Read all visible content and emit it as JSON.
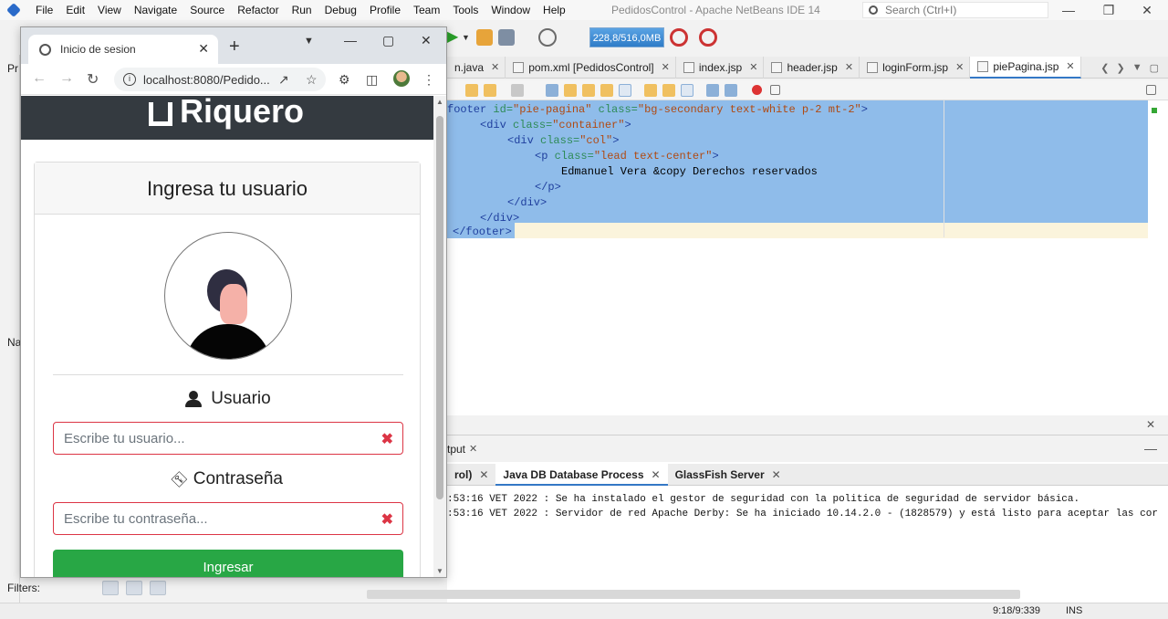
{
  "ide": {
    "title": "PedidosControl - Apache NetBeans IDE 14",
    "menu": [
      "File",
      "Edit",
      "View",
      "Navigate",
      "Source",
      "Refactor",
      "Run",
      "Debug",
      "Profile",
      "Team",
      "Tools",
      "Window",
      "Help"
    ],
    "search_placeholder": "Search (Ctrl+I)",
    "memory": "228,8/516,0MB",
    "left_labels": [
      "Pr",
      "Na"
    ],
    "filters_label": "Filters:",
    "editor_tabs": [
      {
        "label": "n.java",
        "active": false
      },
      {
        "label": "pom.xml [PedidosControl]",
        "active": false
      },
      {
        "label": "index.jsp",
        "active": false
      },
      {
        "label": "header.jsp",
        "active": false
      },
      {
        "label": "loginForm.jsp",
        "active": false
      },
      {
        "label": "piePagina.jsp",
        "active": true
      }
    ],
    "code": {
      "l1": {
        "t1": "footer",
        "a1": " id=",
        "s1": "\"pie-pagina\"",
        "a2": " class=",
        "s2": "\"bg-secondary text-white p-2 mt-2\"",
        "end": ">"
      },
      "l2": {
        "t1": "<div",
        "a1": " class=",
        "s1": "\"container\"",
        "end": ">"
      },
      "l3": {
        "t1": "<div",
        "a1": " class=",
        "s1": "\"col\"",
        "end": ">"
      },
      "l4": {
        "t1": "<p",
        "a1": " class=",
        "s1": "\"lead text-center\"",
        "end": ">"
      },
      "l5": "Edmanuel Vera &copy Derechos reservados",
      "l6": "</p>",
      "l7": "</div>",
      "l8": "</div>",
      "l9": "</footer>"
    },
    "output": {
      "header_label": "tput",
      "tabs": [
        {
          "label": "rol)",
          "active": false
        },
        {
          "label": "Java DB Database Process",
          "active": true
        },
        {
          "label": "GlassFish Server",
          "active": false
        }
      ],
      "lines": [
        ":53:16 VET 2022 : Se ha instalado el gestor de seguridad con la politica de seguridad de servidor básica.",
        ":53:16 VET 2022 : Servidor de red Apache Derby: Se ha iniciado 10.14.2.0 - (1828579) y está listo para aceptar las cor"
      ]
    },
    "status": {
      "position": "9:18/9:339",
      "mode": "INS"
    }
  },
  "browser": {
    "tab_title": "Inicio de sesion",
    "url": "localhost:8080/Pedido...",
    "brand": "Riquero",
    "card_title": "Ingresa tu usuario",
    "username_label": "Usuario",
    "username_placeholder": "Escribe tu usuario...",
    "password_label": "Contraseña",
    "password_placeholder": "Escribe tu contraseña...",
    "submit_label": "Ingresar"
  }
}
